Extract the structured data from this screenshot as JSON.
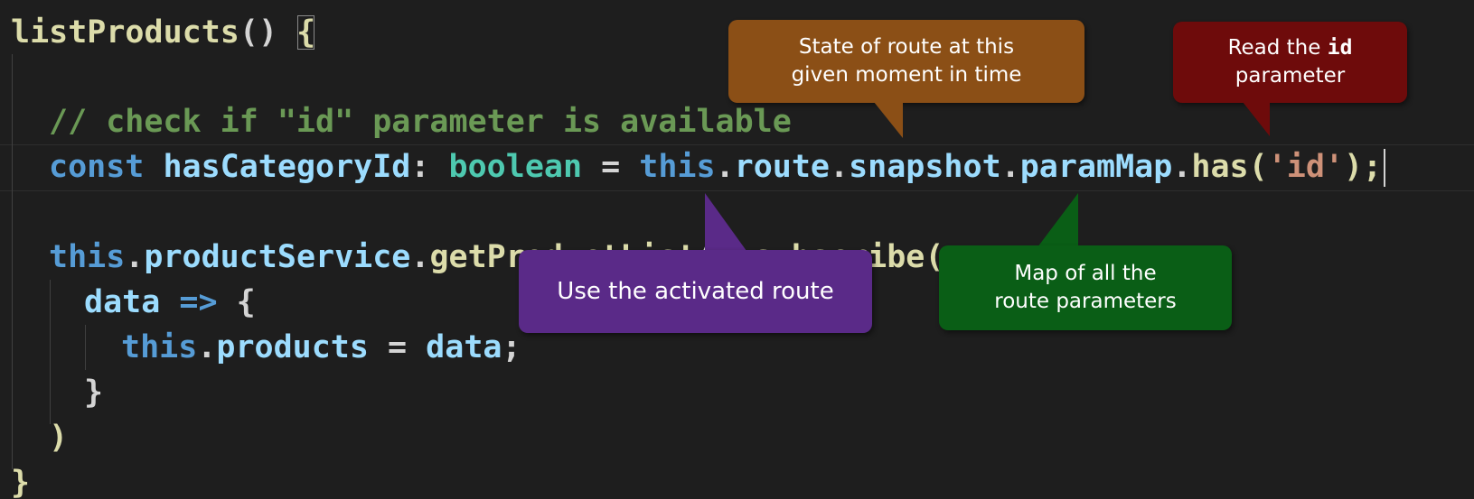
{
  "code": {
    "method_name": "listProducts",
    "method_parens": "() ",
    "method_open_brace": "{",
    "comment": "// check if \"id\" parameter is available",
    "kw_const": "const",
    "var_hasCategoryId": "hasCategoryId",
    "colon": ": ",
    "type_boolean": "boolean",
    "equals": " = ",
    "this_1": "this",
    "dot_1": ".",
    "route": "route",
    "dot_2": ".",
    "snapshot": "snapshot",
    "dot_3": ".",
    "paramMap": "paramMap",
    "dot_4": ".",
    "has": "has",
    "open_paren": "(",
    "str_id": "'id'",
    "close_paren_semi": ");",
    "this_2": "this",
    "dot_5": ".",
    "productService": "productService",
    "dot_6": ".",
    "getProductList": "getProductList",
    "call_parens": "()",
    "dot_7": ".",
    "subscribe": "subscribe",
    "subscribe_open": "(",
    "data_param": "data",
    "arrow": " => ",
    "arrow_open_brace": "{",
    "this_3": "this",
    "dot_8": ".",
    "products": "products",
    "assign": " = ",
    "data_value": "data",
    "semi": ";",
    "arrow_close_brace": "}",
    "subscribe_close": ")",
    "method_close_brace": "}"
  },
  "callouts": {
    "state": {
      "text": "State of route at this\ngiven moment in time",
      "color": "#8b4f16"
    },
    "read_prefix": "Read the ",
    "read_code": "id",
    "read_suffix": "parameter",
    "read_color": "#6e0b0b",
    "activated": {
      "text": "Use the activated route",
      "color": "#5a2a88"
    },
    "map": {
      "text": "Map of all the\nroute parameters",
      "color": "#0a5e16"
    }
  },
  "colors": {
    "background": "#1e1e1e",
    "function": "#dcdcaa",
    "keyword": "#569cd6",
    "variable": "#9cdcfe",
    "type": "#4ec9b0",
    "string": "#ce9178",
    "comment": "#6a9955"
  }
}
